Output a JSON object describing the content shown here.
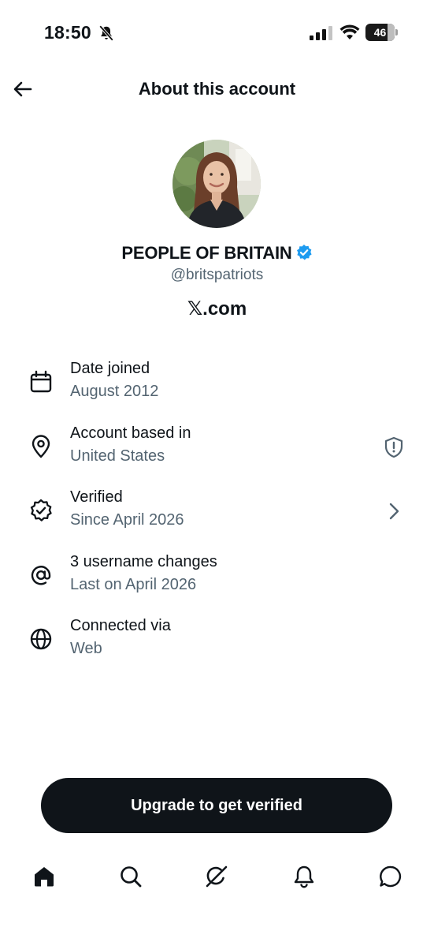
{
  "status_bar": {
    "time": "18:50",
    "battery_level": "46",
    "icons": [
      "bell-off-icon",
      "signal-icon",
      "wifi-icon",
      "battery-icon"
    ]
  },
  "header": {
    "title": "About this account",
    "back_icon": "arrow-left-icon"
  },
  "profile": {
    "display_name": "PEOPLE OF BRITAIN",
    "handle": "@britspatriots",
    "site_glyph": "𝕏",
    "site_suffix": ".com",
    "verified_color": "#1d9bf0"
  },
  "rows": [
    {
      "icon": "calendar-icon",
      "title": "Date joined",
      "subtitle": "August 2012"
    },
    {
      "icon": "location-pin-icon",
      "title": "Account based in",
      "subtitle": "United States",
      "trailing_icon": "shield-alert-icon"
    },
    {
      "icon": "verified-check-icon",
      "title": "Verified",
      "subtitle": "Since April 2026",
      "trailing_icon": "chevron-right-icon"
    },
    {
      "icon": "at-sign-icon",
      "title": "3 username changes",
      "subtitle": "Last on April 2026"
    },
    {
      "icon": "globe-icon",
      "title": "Connected via",
      "subtitle": "Web"
    }
  ],
  "upgrade": {
    "label": "Upgrade to get verified"
  },
  "tab_bar": {
    "tabs": [
      "home-icon",
      "search-icon",
      "grok-icon",
      "notifications-icon",
      "messages-icon"
    ]
  },
  "colors": {
    "text": "#0f1419",
    "secondary": "#536471",
    "accent": "#1d9bf0",
    "button": "#0f1419"
  }
}
